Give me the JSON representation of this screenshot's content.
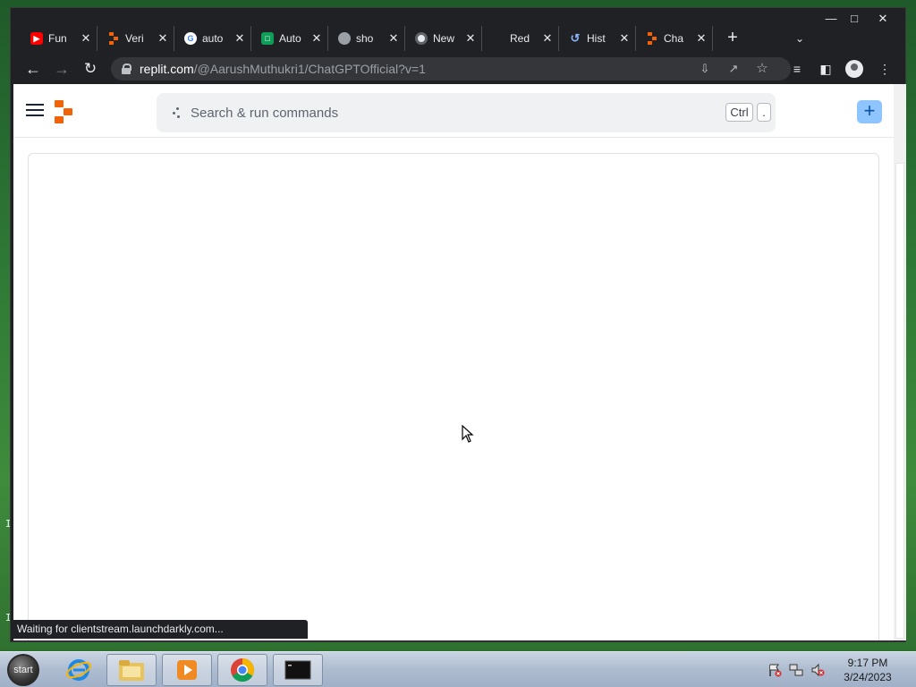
{
  "browser": {
    "tabs": [
      {
        "label": "Fun",
        "icon": "youtube-icon",
        "color": "#ff0000"
      },
      {
        "label": "Veri",
        "icon": "replit-icon",
        "color": "#f26207"
      },
      {
        "label": "auto",
        "icon": "google-icon",
        "color": "#4285f4"
      },
      {
        "label": "Auto",
        "icon": "sheets-icon",
        "color": "#0f9d58"
      },
      {
        "label": "sho",
        "icon": "globe-icon",
        "color": "#9aa0a6"
      },
      {
        "label": "New",
        "icon": "chrome-icon",
        "color": "#e8eaed"
      },
      {
        "label": "Red",
        "icon": "blank-icon",
        "color": "#202124"
      },
      {
        "label": "Hist",
        "icon": "history-icon",
        "color": "#8ab4f8"
      },
      {
        "label": "Cha",
        "icon": "replit-icon",
        "color": "#f26207"
      }
    ],
    "tab_close_glyph": "✕",
    "new_tab_glyph": "+",
    "tab_search_glyph": "⌄",
    "url_domain": "replit.com",
    "url_path": "/@AarushMuthukri1/ChatGPTOfficial?v=1",
    "status_text": "Waiting for clientstream.launchdarkly.com..."
  },
  "replit": {
    "search_placeholder": "Search & run commands",
    "kbd_ctrl": "Ctrl",
    "kbd_dot": ".",
    "create_label": "+"
  },
  "taskbar": {
    "start_label": "start",
    "time": "9:17 PM",
    "date": "3/24/2023"
  },
  "desktop": {
    "side_marks": [
      "I",
      "I"
    ]
  }
}
